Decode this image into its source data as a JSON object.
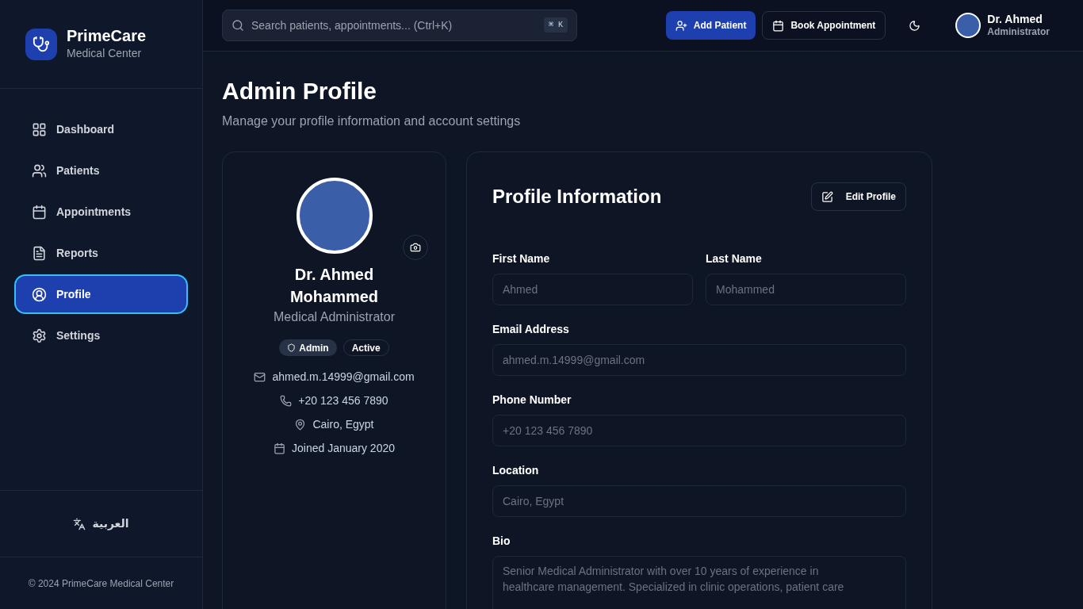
{
  "brand": {
    "name": "PrimeCare",
    "subtitle": "Medical Center"
  },
  "sidebar": {
    "items": [
      {
        "label": "Dashboard",
        "selected": false
      },
      {
        "label": "Patients",
        "selected": false
      },
      {
        "label": "Appointments",
        "selected": false
      },
      {
        "label": "Reports",
        "selected": false
      },
      {
        "label": "Profile",
        "selected": true
      },
      {
        "label": "Settings",
        "selected": false
      }
    ],
    "language": "العربية",
    "footer": "© 2024 PrimeCare Medical Center"
  },
  "header": {
    "search": {
      "placeholder": "Search patients, appointments... (Ctrl+K)",
      "shortcut": "⌘ K"
    },
    "buttons": [
      {
        "label": "Add Patient",
        "kind": "primary"
      },
      {
        "label": "Book Appointment",
        "kind": "outline"
      }
    ],
    "user": {
      "name": "Dr. Ahmed",
      "role": "Administrator"
    }
  },
  "page": {
    "title": "Admin Profile",
    "subtitle": "Manage your profile information and account settings"
  },
  "profile_card": {
    "name": "Dr. Ahmed Mohammed",
    "role": "Medical Administrator",
    "badges": [
      {
        "label": "Admin",
        "kind": "role"
      },
      {
        "label": "Active",
        "kind": "status"
      }
    ],
    "details": [
      "ahmed.m.14999@gmail.com",
      "+20 123 456 7890",
      "Cairo, Egypt",
      "Joined January 2020"
    ]
  },
  "info_form": {
    "title": "Profile Information",
    "edit_button": "Edit Profile",
    "fields": [
      {
        "label": "First Name",
        "value": "Ahmed",
        "disabled": true
      },
      {
        "label": "Last Name",
        "value": "Mohammed",
        "disabled": true
      },
      {
        "label": "Email Address",
        "value": "ahmed.m.14999@gmail.com",
        "disabled": true
      },
      {
        "label": "Phone Number",
        "value": "+20 123 456 7890",
        "disabled": true
      },
      {
        "label": "Location",
        "value": "Cairo, Egypt",
        "disabled": true
      }
    ],
    "bio": {
      "label": "Bio",
      "value": "Senior Medical Administrator with over 10 years of experience in healthcare management. Specialized in clinic operations, patient care",
      "disabled": true
    }
  }
}
